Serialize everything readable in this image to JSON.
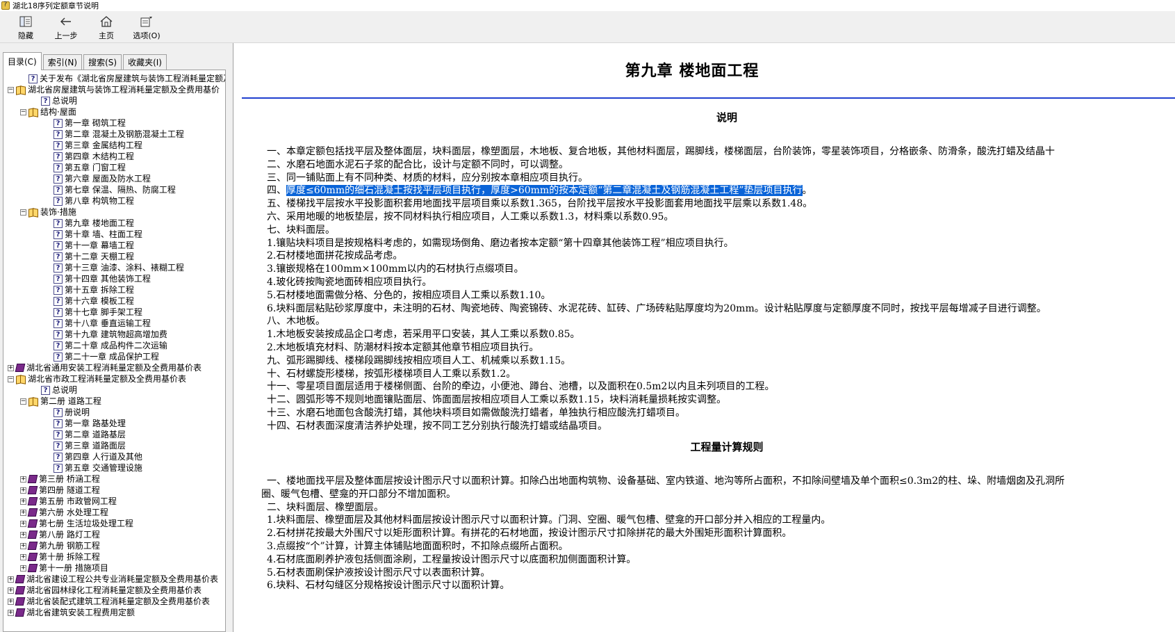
{
  "window": {
    "title": "湖北18序列定额章节说明"
  },
  "toolbar": {
    "buttons": [
      {
        "id": "hide",
        "label": "隐藏"
      },
      {
        "id": "back",
        "label": "上一步"
      },
      {
        "id": "home",
        "label": "主页"
      },
      {
        "id": "options",
        "label": "选项(O)"
      }
    ]
  },
  "tabs": [
    "目录(C)",
    "索引(N)",
    "搜索(S)",
    "收藏夹(I)"
  ],
  "tree": [
    {
      "level": 1,
      "icon": "page",
      "label": "关于发布《湖北省房屋建筑与装饰工程消耗量定额及"
    },
    {
      "level": 0,
      "icon": "book-open",
      "exp": "-",
      "label": "湖北省房屋建筑与装饰工程消耗量定额及全费用基价"
    },
    {
      "level": 2,
      "icon": "page",
      "label": "总说明"
    },
    {
      "level": 1,
      "icon": "book-open",
      "exp": "-",
      "label": "结构·屋面"
    },
    {
      "level": 3,
      "icon": "page",
      "label": "第一章 砌筑工程"
    },
    {
      "level": 3,
      "icon": "page",
      "label": "第二章 混凝土及钢筋混凝土工程"
    },
    {
      "level": 3,
      "icon": "page",
      "label": "第三章 金属结构工程"
    },
    {
      "level": 3,
      "icon": "page",
      "label": "第四章 木结构工程"
    },
    {
      "level": 3,
      "icon": "page",
      "label": "第五章 门窗工程"
    },
    {
      "level": 3,
      "icon": "page",
      "label": "第六章 屋面及防水工程"
    },
    {
      "level": 3,
      "icon": "page",
      "label": "第七章 保温、隔热、防腐工程"
    },
    {
      "level": 3,
      "icon": "page",
      "label": "第八章 构筑物工程"
    },
    {
      "level": 1,
      "icon": "book-open",
      "exp": "-",
      "label": "装饰·措施"
    },
    {
      "level": 3,
      "icon": "page",
      "label": "第九章 楼地面工程"
    },
    {
      "level": 3,
      "icon": "page",
      "label": "第十章 墙、柱面工程"
    },
    {
      "level": 3,
      "icon": "page",
      "label": "第十一章 幕墙工程"
    },
    {
      "level": 3,
      "icon": "page",
      "label": "第十二章 天棚工程"
    },
    {
      "level": 3,
      "icon": "page",
      "label": "第十三章 油漆、涂料、裱糊工程"
    },
    {
      "level": 3,
      "icon": "page",
      "label": "第十四章 其他装饰工程"
    },
    {
      "level": 3,
      "icon": "page",
      "label": "第十五章 拆除工程"
    },
    {
      "level": 3,
      "icon": "page",
      "label": "第十六章 模板工程"
    },
    {
      "level": 3,
      "icon": "page",
      "label": "第十七章 脚手架工程"
    },
    {
      "level": 3,
      "icon": "page",
      "label": "第十八章 垂直运输工程"
    },
    {
      "level": 3,
      "icon": "page",
      "label": "第十九章 建筑物超高增加费"
    },
    {
      "level": 3,
      "icon": "page",
      "label": "第二十章 成品构件二次运输"
    },
    {
      "level": 3,
      "icon": "page",
      "label": "第二十一章 成品保护工程"
    },
    {
      "level": 0,
      "icon": "book-closed",
      "exp": "+",
      "label": "湖北省通用安装工程消耗量定额及全费用基价表"
    },
    {
      "level": 0,
      "icon": "book-open",
      "exp": "-",
      "label": "湖北省市政工程消耗量定额及全费用基价表"
    },
    {
      "level": 2,
      "icon": "page",
      "label": "总说明"
    },
    {
      "level": 1,
      "icon": "book-open",
      "exp": "-",
      "label": "第二册 道路工程"
    },
    {
      "level": 3,
      "icon": "page",
      "label": "册说明"
    },
    {
      "level": 3,
      "icon": "page",
      "label": "第一章 路基处理"
    },
    {
      "level": 3,
      "icon": "page",
      "label": "第二章 道路基层"
    },
    {
      "level": 3,
      "icon": "page",
      "label": "第三章 道路面层"
    },
    {
      "level": 3,
      "icon": "page",
      "label": "第四章 人行道及其他"
    },
    {
      "level": 3,
      "icon": "page",
      "label": "第五章 交通管理设施"
    },
    {
      "level": 1,
      "icon": "book-closed",
      "exp": "+",
      "label": "第三册 桥涵工程"
    },
    {
      "level": 1,
      "icon": "book-closed",
      "exp": "+",
      "label": "第四册 隧道工程"
    },
    {
      "level": 1,
      "icon": "book-closed",
      "exp": "+",
      "label": "第五册 市政管网工程"
    },
    {
      "level": 1,
      "icon": "book-closed",
      "exp": "+",
      "label": "第六册 水处理工程"
    },
    {
      "level": 1,
      "icon": "book-closed",
      "exp": "+",
      "label": "第七册 生活垃圾处理工程"
    },
    {
      "level": 1,
      "icon": "book-closed",
      "exp": "+",
      "label": "第八册 路灯工程"
    },
    {
      "level": 1,
      "icon": "book-closed",
      "exp": "+",
      "label": "第九册 钢筋工程"
    },
    {
      "level": 1,
      "icon": "book-closed",
      "exp": "+",
      "label": "第十册 拆除工程"
    },
    {
      "level": 1,
      "icon": "book-closed",
      "exp": "+",
      "label": "第十一册 措施项目"
    },
    {
      "level": 0,
      "icon": "book-closed",
      "exp": "+",
      "label": "湖北省建设工程公共专业消耗量定额及全费用基价表"
    },
    {
      "level": 0,
      "icon": "book-closed",
      "exp": "+",
      "label": "湖北省园林绿化工程消耗量定额及全费用基价表"
    },
    {
      "level": 0,
      "icon": "book-closed",
      "exp": "+",
      "label": "湖北省装配式建筑工程消耗量定额及全费用基价表"
    },
    {
      "level": 0,
      "icon": "book-closed",
      "exp": "+",
      "label": "湖北省建筑安装工程费用定额"
    }
  ],
  "document": {
    "chapter_title": "第九章  楼地面工程",
    "explanation_head": "说明",
    "explanation": [
      {
        "text": "一、本章定额包括找平层及整体面层，块料面层，橡塑面层，木地板、复合地板，其他材料面层，踢脚线，楼梯面层，台阶装饰，零星装饰项目，分格嵌条、防滑条，酸洗打蜡及结晶十"
      },
      {
        "text": "二、水磨石地面水泥石子浆的配合比，设计与定额不同时，可以调整。"
      },
      {
        "text": "三、同一铺贴面上有不同种类、材质的材料，应分别按本章相应项目执行。"
      },
      {
        "prefix": "四、",
        "hl": "厚度≤60mm的细石混凝土按找平层项目执行，厚度>60mm的按本定额“第二章混凝土及钢筋混凝土工程”垫层项目执行",
        "suffix": "。"
      },
      {
        "text": "五、楼梯找平层按水平投影面积套用地面找平层项目乘以系数1.365，台阶找平层按水平投影面套用地面找平层乘以系数1.48。"
      },
      {
        "text": "六、采用地暖的地板垫层，按不同材料执行相应项目，人工乘以系数1.3，材料乘以系数0.95。"
      },
      {
        "text": "七、块料面层。"
      },
      {
        "text": "1.镶贴块料项目是按规格料考虑的，如需现场倒角、磨边者按本定额“第十四章其他装饰工程”相应项目执行。"
      },
      {
        "text": "2.石材楼地面拼花按成品考虑。"
      },
      {
        "text": "3.镶嵌规格在100mm×100mm以内的石材执行点缀项目。"
      },
      {
        "text": "4.玻化砖按陶瓷地面砖相应项目执行。"
      },
      {
        "text": "5.石材楼地面需做分格、分色的，按相应项目人工乘以系数1.10。"
      },
      {
        "text": "6.块料面层粘贴砂浆厚度中，未注明的石材、陶瓷地砖、陶瓷锦砖、水泥花砖、缸砖、广场砖粘贴厚度均为20mm。设计粘贴厚度与定额厚度不同时，按找平层每增减子目进行调整。"
      },
      {
        "text": "八、木地板。"
      },
      {
        "text": "1.木地板安装按成品企口考虑，若采用平口安装，其人工乘以系数0.85。"
      },
      {
        "text": "2.木地板填充材料、防潮材料按本定额其他章节相应项目执行。"
      },
      {
        "text": "九、弧形踢脚线、楼梯段踢脚线按相应项目人工、机械乘以系数1.15。"
      },
      {
        "text": "十、石材螺旋形楼梯，按弧形楼梯项目人工乘以系数1.2。"
      },
      {
        "text": "十一、零星项目面层适用于楼梯侧面、台阶的牵边，小便池、蹲台、池槽，以及面积在0.5m2以内且未列项目的工程。"
      },
      {
        "text": "十二、圆弧形等不规则地面镶贴面层、饰面面层按相应项目人工乘以系数1.15，块料消耗量损耗按实调整。"
      },
      {
        "text": "十三、水磨石地面包含酸洗打蜡，其他块料项目如需做酸洗打蜡者，单独执行相应酸洗打蜡项目。"
      },
      {
        "text": "十四、石材表面深度清洁养护处理，按不同工艺分别执行酸洗打蜡或结晶项目。"
      }
    ],
    "rules_head": "工程量计算规则",
    "rules": [
      {
        "text": "一、楼地面找平层及整体面层按设计图示尺寸以面积计算。扣除凸出地面构筑物、设备基础、室内铁道、地沟等所占面积，不扣除间壁墙及单个面积≤0.3m2的柱、垛、附墙烟囱及孔洞所"
      },
      {
        "text": "圈、暖气包槽、壁龛的开口部分不增加面积。",
        "indent": "neg"
      },
      {
        "text": "二、块料面层、橡塑面层。"
      },
      {
        "text": "1.块料面层、橡塑面层及其他材料面层按设计图示尺寸以面积计算。门洞、空圈、暖气包槽、壁龛的开口部分并入相应的工程量内。"
      },
      {
        "text": "2.石材拼花按最大外围尺寸以矩形面积计算。有拼花的石材地面，按设计图示尺寸扣除拼花的最大外围矩形面积计算面积。"
      },
      {
        "text": "3.点缀按“个”计算，计算主体铺贴地面面积时，不扣除点缀所占面积。"
      },
      {
        "text": "4.石材底面刷养护液包括侧面涂刷，工程量按设计图示尺寸以底面积加侧面面积计算。"
      },
      {
        "text": "5.石材表面刷保护液按设计图示尺寸以表面积计算。"
      },
      {
        "text": "6.块料、石材勾缝区分规格按设计图示尺寸以面积计算。"
      }
    ]
  }
}
